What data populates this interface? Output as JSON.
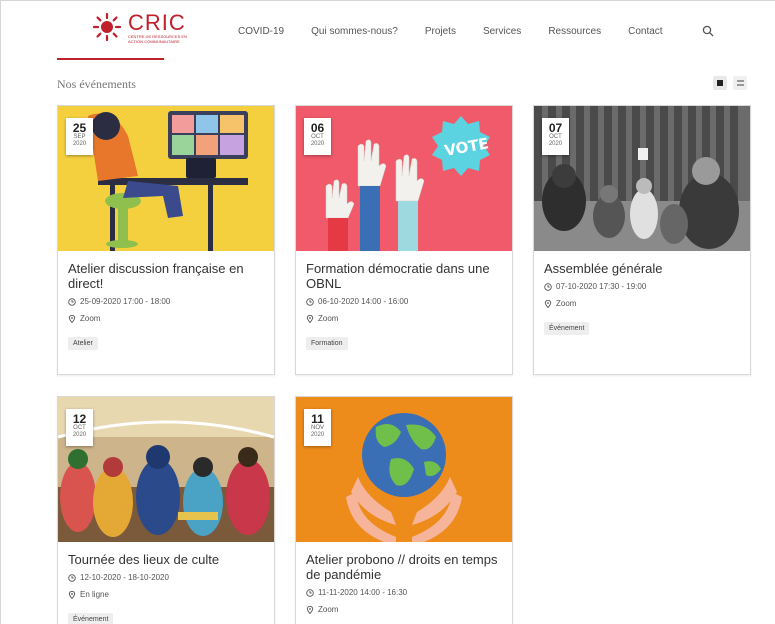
{
  "brand": {
    "name": "CRIC",
    "tagline": "CENTRE DE RESSOURCES EN ACTION COMMUNAUTAIRE",
    "accent": "#c0202a"
  },
  "nav": {
    "items": [
      "COVID-19",
      "Qui sommes-nous?",
      "Projets",
      "Services",
      "Ressources",
      "Contact"
    ],
    "search_icon": "search-icon"
  },
  "section": {
    "title": "Nos événements"
  },
  "view_toggle": {
    "grid_icon": "grid-view-icon",
    "list_icon": "list-view-icon"
  },
  "events": [
    {
      "day": "25",
      "month": "SEP",
      "year": "2020",
      "title": "Atelier discussion française en direct!",
      "datetime": "25-09-2020 17:00 - 18:00",
      "location": "Zoom",
      "tag": "Atelier",
      "image_bg": "#f4d03f"
    },
    {
      "day": "06",
      "month": "OCT",
      "year": "2020",
      "title": "Formation démocratie dans une OBNL",
      "datetime": "06-10-2020 14:00 - 16:00",
      "location": "Zoom",
      "tag": "Formation",
      "image_bg": "#f05a6a"
    },
    {
      "day": "07",
      "month": "OCT",
      "year": "2020",
      "title": "Assemblée générale",
      "datetime": "07-10-2020 17:30 - 19:00",
      "location": "Zoom",
      "tag": "Événement",
      "image_bg": "#555555"
    },
    {
      "day": "12",
      "month": "OCT",
      "year": "2020",
      "title": "Tournée des lieux de culte",
      "datetime": "12-10-2020 - 18-10-2020",
      "location": "En ligne",
      "tag": "Événement",
      "image_bg": "#b89a6a"
    },
    {
      "day": "11",
      "month": "NOV",
      "year": "2020",
      "title": "Atelier probono // droits en temps de pandémie",
      "datetime": "11-11-2020 14:00 - 16:30",
      "location": "Zoom",
      "tag": "",
      "image_bg": "#ee8c1b"
    }
  ]
}
